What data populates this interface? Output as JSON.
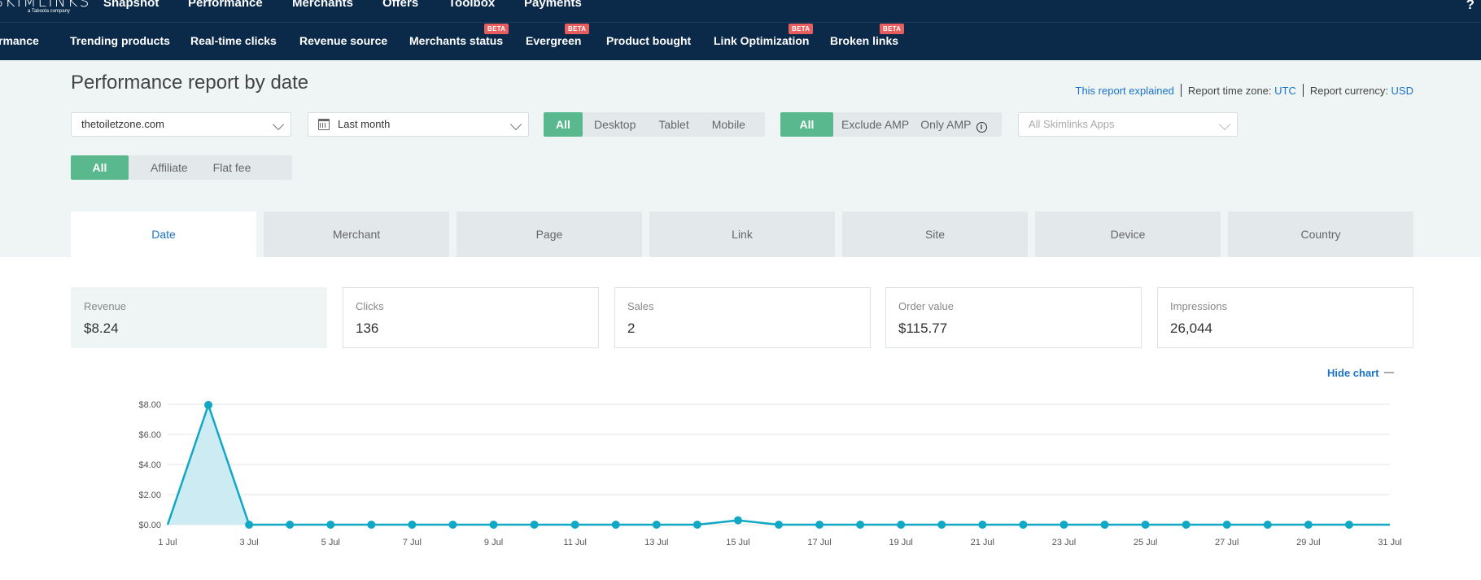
{
  "app": {
    "logo_text": "SKIMLINKS",
    "logo_sub": "a Taboola company",
    "help_label": "?"
  },
  "topnav": [
    {
      "label": "Snapshot",
      "active": false
    },
    {
      "label": "Performance",
      "active": true
    },
    {
      "label": "Merchants",
      "active": false
    },
    {
      "label": "Offers",
      "active": false
    },
    {
      "label": "Toolbox",
      "active": false
    },
    {
      "label": "Payments",
      "active": false
    }
  ],
  "subnav": [
    {
      "label": "rmance",
      "active": true,
      "beta": false
    },
    {
      "label": "Trending products",
      "active": false,
      "beta": false
    },
    {
      "label": "Real-time clicks",
      "active": false,
      "beta": false
    },
    {
      "label": "Revenue source",
      "active": false,
      "beta": false
    },
    {
      "label": "Merchants status",
      "active": false,
      "beta": true
    },
    {
      "label": "Evergreen",
      "active": false,
      "beta": true
    },
    {
      "label": "Product bought",
      "active": false,
      "beta": false
    },
    {
      "label": "Link Optimization",
      "active": false,
      "beta": true
    },
    {
      "label": "Broken links",
      "active": false,
      "beta": true
    }
  ],
  "beta_label": "BETA",
  "page": {
    "title": "Performance report by date",
    "explained_link": "This report explained",
    "timezone_label": "Report time zone: ",
    "timezone_value": "UTC",
    "currency_label": "Report currency: ",
    "currency_value": "USD"
  },
  "filters": {
    "site_select": "thetoiletzone.com",
    "date_select": "Last month",
    "device_options": [
      "All",
      "Desktop",
      "Tablet",
      "Mobile"
    ],
    "device_selected": "All",
    "amp_options": [
      "All",
      "Exclude AMP",
      "Only AMP"
    ],
    "amp_selected": "All",
    "apps_placeholder": "All Skimlinks Apps",
    "type_options": [
      "All",
      "Affiliate",
      "Flat fee"
    ],
    "type_selected": "All"
  },
  "report_tabs": [
    "Date",
    "Merchant",
    "Page",
    "Link",
    "Site",
    "Device",
    "Country"
  ],
  "report_tab_active": "Date",
  "stats": [
    {
      "label": "Revenue",
      "value": "$8.24",
      "active": true
    },
    {
      "label": "Clicks",
      "value": "136",
      "active": false
    },
    {
      "label": "Sales",
      "value": "2",
      "active": false
    },
    {
      "label": "Order value",
      "value": "$115.77",
      "active": false
    },
    {
      "label": "Impressions",
      "value": "26,044",
      "active": false
    }
  ],
  "hide_chart_label": "Hide chart",
  "colors": {
    "nav_bg": "#0b2a4a",
    "accent_blue": "#29a4dc",
    "link_blue": "#1a73c7",
    "green": "#5ab88e",
    "beta_red": "#e85d5d",
    "series": "#10a8c4"
  },
  "chart_data": {
    "type": "area",
    "x": [
      "1 Jul",
      "2 Jul",
      "3 Jul",
      "4 Jul",
      "5 Jul",
      "6 Jul",
      "7 Jul",
      "8 Jul",
      "9 Jul",
      "10 Jul",
      "11 Jul",
      "12 Jul",
      "13 Jul",
      "14 Jul",
      "15 Jul",
      "16 Jul",
      "17 Jul",
      "18 Jul",
      "19 Jul",
      "20 Jul",
      "21 Jul",
      "22 Jul",
      "23 Jul",
      "24 Jul",
      "25 Jul",
      "26 Jul",
      "27 Jul",
      "28 Jul",
      "29 Jul",
      "30 Jul",
      "31 Jul"
    ],
    "x_tick_labels": [
      "1 Jul",
      "3 Jul",
      "5 Jul",
      "7 Jul",
      "9 Jul",
      "11 Jul",
      "13 Jul",
      "15 Jul",
      "17 Jul",
      "19 Jul",
      "21 Jul",
      "23 Jul",
      "25 Jul",
      "27 Jul",
      "29 Jul",
      "31 Jul"
    ],
    "y_tick_labels": [
      "$0.00",
      "$2.00",
      "$4.00",
      "$6.00",
      "$8.00"
    ],
    "series": [
      {
        "values": [
          0,
          7.95,
          0,
          0,
          0,
          0,
          0,
          0,
          0,
          0,
          0,
          0,
          0,
          0,
          0.29,
          0,
          0,
          0,
          0,
          0,
          0,
          0,
          0,
          0,
          0,
          0,
          0,
          0,
          0,
          0,
          0
        ]
      }
    ],
    "ylim": [
      0,
      8
    ],
    "grid": true,
    "fill_first_segment": true
  }
}
